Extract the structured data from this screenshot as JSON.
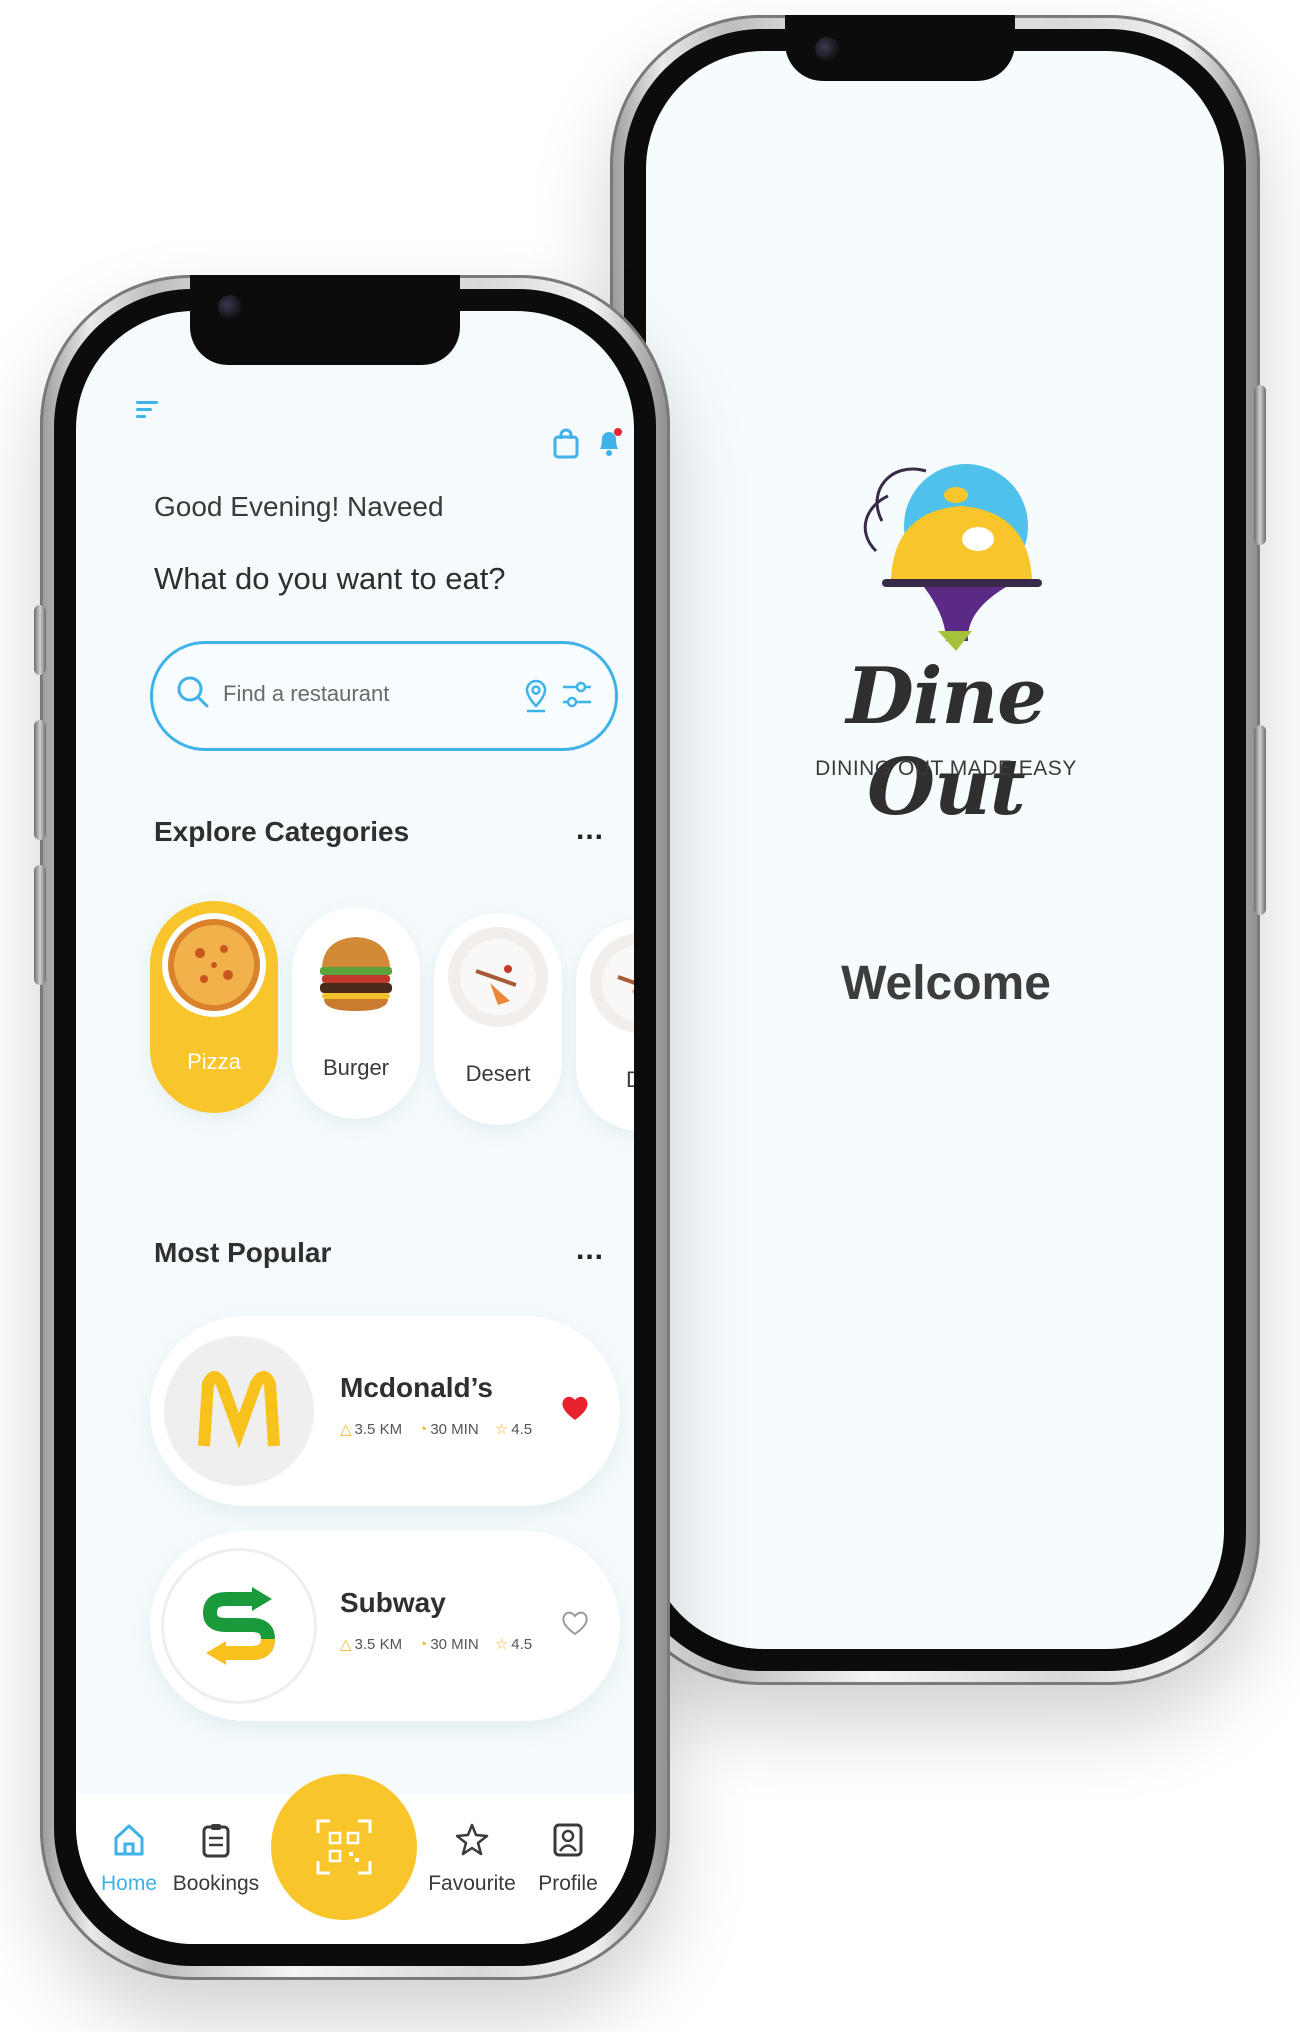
{
  "welcome_screen": {
    "brand_name": "Dine Out",
    "tagline": "DINING OUT MADE EASY",
    "welcome_text": "Welcome"
  },
  "home_screen": {
    "greeting": "Good Evening! Naveed",
    "question": "What do you want to eat?",
    "search": {
      "placeholder": "Find a restaurant"
    },
    "categories_title": "Explore Categories",
    "more_label": "...",
    "categories": [
      {
        "label": "Pizza",
        "active": true
      },
      {
        "label": "Burger",
        "active": false
      },
      {
        "label": "Desert",
        "active": false
      },
      {
        "label": "De",
        "active": false
      }
    ],
    "popular_title": "Most Popular",
    "restaurants": [
      {
        "name": "Mcdonald’s",
        "distance": "3.5 KM",
        "time": "30 MIN",
        "rating": "4.5",
        "favourite": true
      },
      {
        "name": "Subway",
        "distance": "3.5 KM",
        "time": "30 MIN",
        "rating": "4.5",
        "favourite": false
      }
    ],
    "tabs": [
      {
        "label": "Home",
        "icon": "home-icon",
        "active": true
      },
      {
        "label": "Bookings",
        "icon": "clipboard-icon",
        "active": false
      },
      {
        "label": "Favourite",
        "icon": "star-icon",
        "active": false
      },
      {
        "label": "Profile",
        "icon": "profile-icon",
        "active": false
      }
    ]
  },
  "colors": {
    "accent_blue": "#3fb2e8",
    "accent_yellow": "#f8c52b",
    "heart_red": "#e8232f",
    "screen_bg": "#f5fbfd"
  }
}
